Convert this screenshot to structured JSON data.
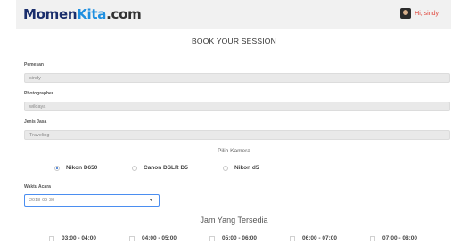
{
  "header": {
    "logo": {
      "part1": "Momen",
      "part2": "Kita",
      "part3": ".com"
    },
    "user_label": "Hi, sindy"
  },
  "page_title": "BOOK YOUR SESSION",
  "form": {
    "pemesan_label": "Pemesan",
    "pemesan_value": "sindy",
    "photographer_label": "Photographer",
    "photographer_value": "wildaya",
    "jenis_label": "Jenis Jasa",
    "jenis_value": "Traveling",
    "kamera_label": "Pilih Kamera",
    "kamera_options": [
      {
        "label": "Nikon D650",
        "checked": true
      },
      {
        "label": "Canon DSLR D5",
        "checked": false
      },
      {
        "label": "Nikon d5",
        "checked": false
      }
    ],
    "waktu_label": "Waktu Acara",
    "waktu_value": "2018-09-30",
    "jam_label": "Jam Yang Tersedia",
    "slots": [
      "03:00 - 04:00",
      "04:00 - 05:00",
      "05:00 - 06:00",
      "06:00 - 07:00",
      "07:00 - 08:00"
    ]
  }
}
